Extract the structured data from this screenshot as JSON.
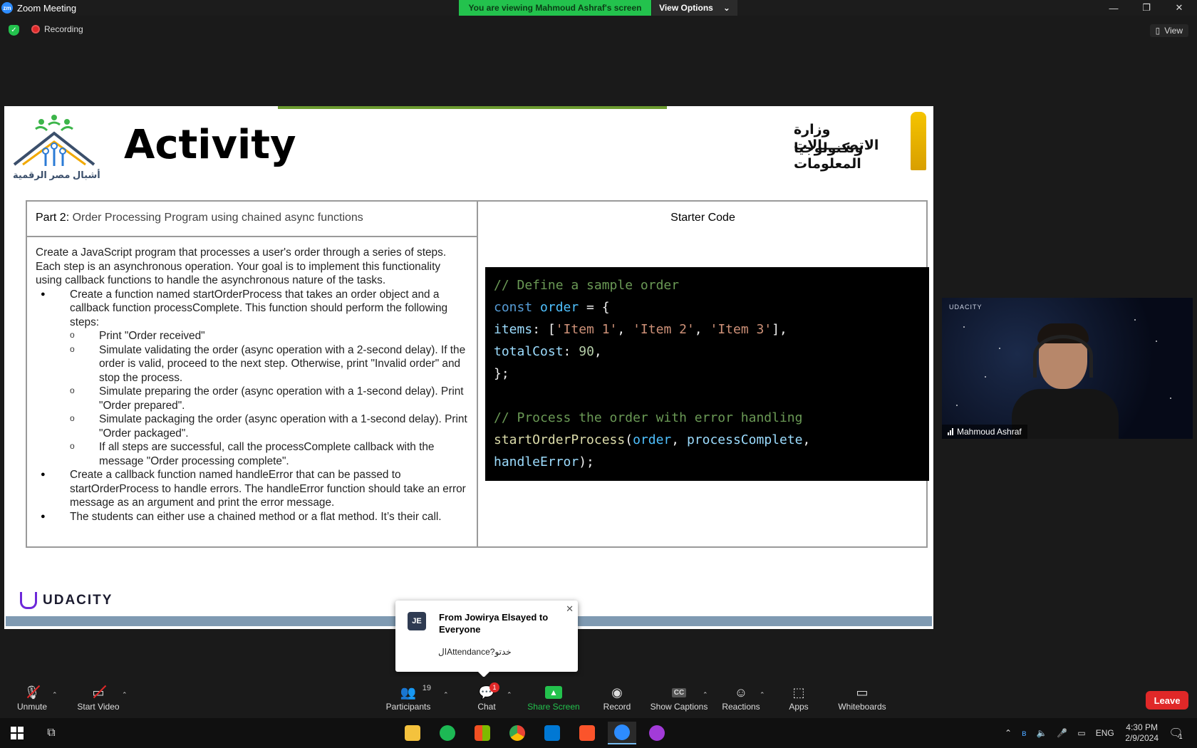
{
  "window": {
    "title": "Zoom Meeting",
    "app_icon": "zm",
    "banner": "You are viewing Mahmoud Ashraf's screen",
    "view_options": "View Options",
    "minimize_icon": "—",
    "maximize_icon": "❐",
    "close_icon": "✕"
  },
  "status": {
    "recording": "Recording",
    "view": "View"
  },
  "slide": {
    "title": "Activity",
    "left_logo_text": "أشبال مصر الرقمية",
    "right_logo_line1": "وزارة الاتصـــــالات",
    "right_logo_line2": "وتكنولوجيا المعلومات",
    "part_label": "Part 2:",
    "part_title": " Order Processing Program using chained async functions",
    "intro": "Create a JavaScript program that processes a user's order through a series of steps. Each step is an asynchronous operation. Your goal is to implement this functionality using callback functions to handle the asynchronous nature of the tasks.",
    "bullet1": "Create a function named startOrderProcess that takes an order object and a callback function processComplete. This function should perform the following steps:",
    "sub1": "Print \"Order received\"",
    "sub2": "Simulate validating the order (async operation with a 2-second delay). If the order is valid, proceed to the next step. Otherwise, print \"Invalid order\" and stop the process.",
    "sub3": "Simulate preparing the order (async operation with a 1-second delay). Print \"Order prepared\".",
    "sub4": "Simulate packaging the order (async operation with a 1-second delay). Print \"Order packaged\".",
    "sub5": "If all steps are successful, call the processComplete callback with the message \"Order processing complete\".",
    "bullet2": "Create a callback function named handleError that can be passed to startOrderProcess to handle errors. The handleError function should take an error message as an argument and print the error message.",
    "bullet3": "The students can either use a chained method or a flat method. It’s their call.",
    "starter_title": "Starter Code",
    "code": {
      "comment1": "// Define a sample order",
      "kw_const": "const",
      "var_order": "order",
      "eq_brace": " = {",
      "prop_items": "items",
      "items_open": ": [",
      "item1": "'Item 1'",
      "item2": "'Item 2'",
      "item3": "'Item 3'",
      "comma_sp": ", ",
      "items_close": "],",
      "prop_total": "totalCost",
      "colon_sp": ": ",
      "num_90": "90",
      "comma": ",",
      "close_brace": "};",
      "comment2": "// Process the order with error handling",
      "fn_start": "startOrderProcess",
      "paren_open": "(",
      "arg_order": "order",
      "arg_complete": "processComplete",
      "arg_error": "handleError",
      "paren_close": ");"
    },
    "footer_brand": "UDACITY"
  },
  "video": {
    "brand": "UDACITY",
    "name": "Mahmoud Ashraf"
  },
  "chat_toast": {
    "avatar": "JE",
    "from": "From Jowirya Elsayed to Everyone",
    "message": "الAttendance?خدتو"
  },
  "toolbar": {
    "unmute": "Unmute",
    "start_video": "Start Video",
    "participants": "Participants",
    "participants_count": "19",
    "chat": "Chat",
    "chat_badge": "1",
    "share_screen": "Share Screen",
    "record": "Record",
    "show_captions": "Show Captions",
    "captions_icon": "CC",
    "reactions": "Reactions",
    "apps": "Apps",
    "whiteboards": "Whiteboards",
    "leave": "Leave"
  },
  "taskbar": {
    "language": "ENG",
    "time": "4:30 PM",
    "date": "2/9/2024",
    "notifications": "1"
  }
}
